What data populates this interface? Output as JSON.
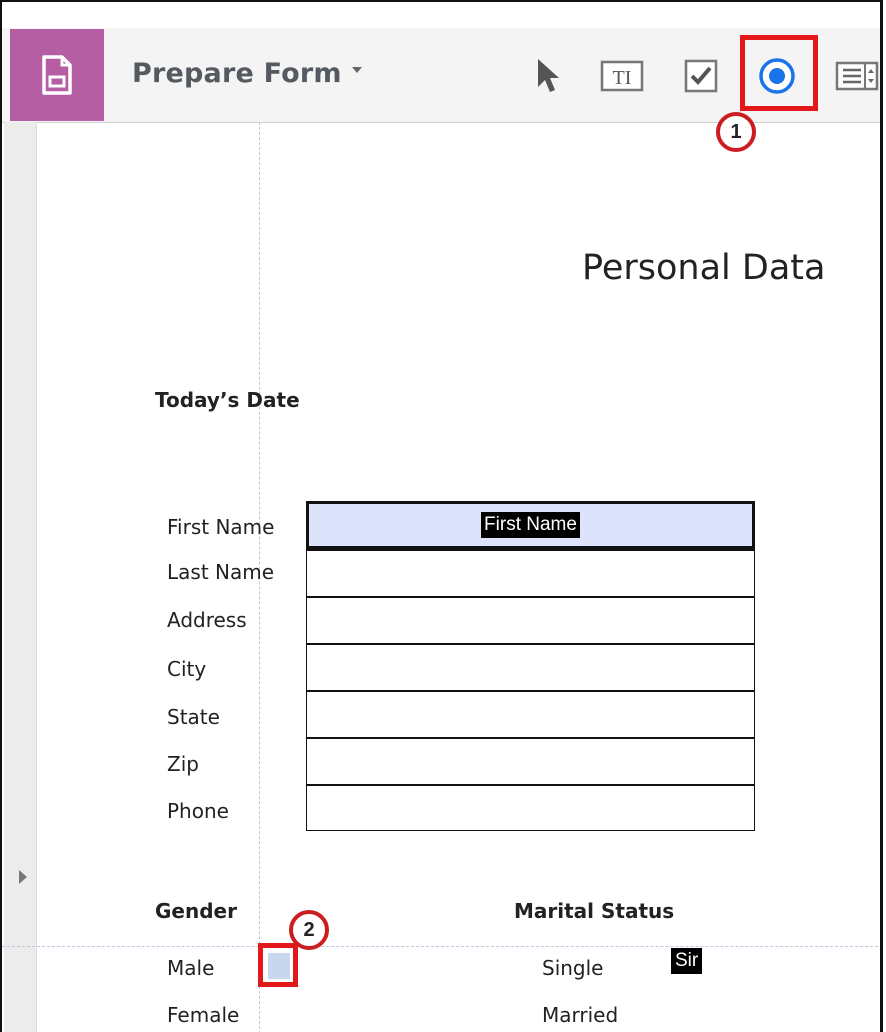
{
  "toolbar": {
    "title": "Prepare Form",
    "tools": [
      {
        "name": "select-tool",
        "icon": "pointer-arrow-icon"
      },
      {
        "name": "text-field-tool",
        "icon": "text-field-icon",
        "glyph": "TI"
      },
      {
        "name": "checkbox-tool",
        "icon": "checkbox-icon"
      },
      {
        "name": "radio-button-tool",
        "icon": "radio-button-icon"
      },
      {
        "name": "list-box-tool",
        "icon": "list-box-icon"
      }
    ]
  },
  "callouts": {
    "one": "1",
    "two": "2"
  },
  "document": {
    "title": "Personal Data",
    "todays_date_label": "Today’s Date",
    "fields": [
      {
        "label": "First Name"
      },
      {
        "label": "Last Name"
      },
      {
        "label": "Address"
      },
      {
        "label": "City"
      },
      {
        "label": "State"
      },
      {
        "label": "Zip"
      },
      {
        "label": "Phone"
      }
    ],
    "first_field_tag": "First Name",
    "gender_label": "Gender",
    "gender_options": [
      "Male",
      "Female"
    ],
    "marital_label": "Marital Status",
    "marital_options": [
      "Single",
      "Married"
    ],
    "marital_field_tag": "Sir"
  },
  "colors": {
    "app_accent": "#b55ea3",
    "highlight_red": "#e2181a",
    "radio_blue": "#1a73e8",
    "field_fill": "#dde3fb"
  }
}
